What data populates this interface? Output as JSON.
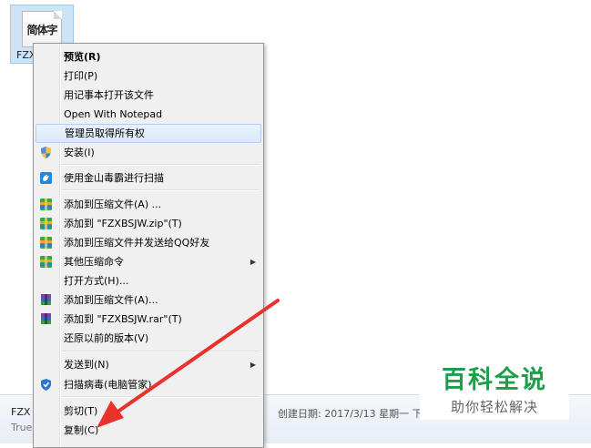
{
  "file": {
    "icon_text": "简体字",
    "name_label": "FZX"
  },
  "details": {
    "name": "FZX",
    "type": "True",
    "extra": "。",
    "created": "创建日期: 2017/3/13 星期一 下"
  },
  "menu": {
    "items": [
      {
        "label": "预览(R)",
        "bold": true
      },
      {
        "label": "打印(P)"
      },
      {
        "label": "用记事本打开该文件"
      },
      {
        "label": "Open With Notepad"
      },
      {
        "label": "管理员取得所有权",
        "highlight": true
      },
      {
        "label": "安装(I)",
        "icon": "uac-shield-icon"
      },
      {
        "label": "使用金山毒霸进行扫描",
        "icon": "kingsoft-antivirus-icon"
      },
      {
        "label": "添加到压缩文件(A) ...",
        "icon": "archive-icon"
      },
      {
        "label": "添加到 \"FZXBSJW.zip\"(T)",
        "icon": "archive-icon"
      },
      {
        "label": "添加到压缩文件并发送给QQ好友",
        "icon": "archive-icon"
      },
      {
        "label": "其他压缩命令",
        "icon": "archive-icon",
        "submenu": true
      },
      {
        "label": "打开方式(H)..."
      },
      {
        "label": "添加到压缩文件(A)...",
        "icon": "winrar-icon"
      },
      {
        "label": "添加到 \"FZXBSJW.rar\"(T)",
        "icon": "winrar-icon"
      },
      {
        "label": "还原以前的版本(V)"
      },
      {
        "label": "发送到(N)",
        "submenu": true
      },
      {
        "label": "扫描病毒(电脑管家)",
        "icon": "tencent-pc-manager-icon"
      },
      {
        "label": "剪切(T)"
      },
      {
        "label": "复制(C)"
      }
    ]
  },
  "watermark": {
    "title": "百科全说",
    "subtitle": "助你轻松解决"
  },
  "colors": {
    "annotation": "#e8322b",
    "watermark_green": "#1f9e4a",
    "highlight_border": "#aecff7"
  }
}
